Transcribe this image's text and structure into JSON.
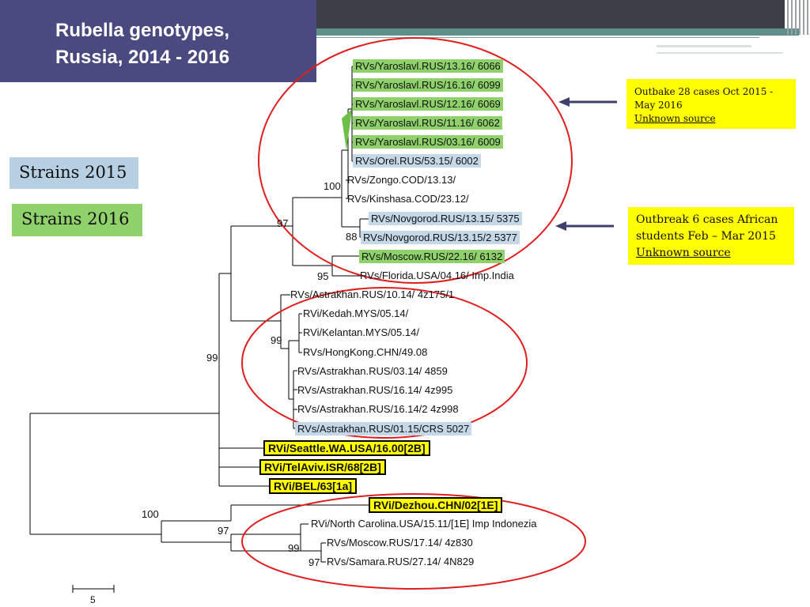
{
  "slide": {
    "title_line1": "Rubella genotypes,",
    "title_line2": "Russia, 2014 - 2016"
  },
  "legend": {
    "strains_2015": "Strains 2015",
    "strains_2016": "Strains 2016",
    "color_2015": "#b7cfe2",
    "color_2016": "#8fd16a"
  },
  "leaves": [
    {
      "label": "RVs/Yaroslavl.RUS/13.16/ 6066",
      "highlight": "green"
    },
    {
      "label": "RVs/Yaroslavl.RUS/16.16/ 6099",
      "highlight": "green"
    },
    {
      "label": "RVs/Yaroslavl.RUS/12.16/ 6069",
      "highlight": "green"
    },
    {
      "label": "RVs/Yaroslavl.RUS/11.16/ 6062",
      "highlight": "green"
    },
    {
      "label": "RVs/Yaroslavl.RUS/03.16/ 6009",
      "highlight": "green"
    },
    {
      "label": "RVs/Orel.RUS/53.15/ 6002",
      "highlight": "blue"
    },
    {
      "label": "RVs/Zongo.COD/13.13/",
      "highlight": "none"
    },
    {
      "label": "RVs/Kinshasa.COD/23.12/",
      "highlight": "none"
    },
    {
      "label": "RVs/Novgorod.RUS/13.15/ 5375",
      "highlight": "blue"
    },
    {
      "label": "RVs/Novgorod.RUS/13.15/2 5377",
      "highlight": "blue"
    },
    {
      "label": "RVs/Moscow.RUS/22.16/ 6132",
      "highlight": "green"
    },
    {
      "label": "RVs/Florida.USA/04.16/ Imp.India",
      "highlight": "none"
    },
    {
      "label": "RVs/Astrakhan.RUS/10.14/ 4z175/1",
      "highlight": "none"
    },
    {
      "label": "RVi/Kedah.MYS/05.14/",
      "highlight": "none"
    },
    {
      "label": "RVi/Kelantan.MYS/05.14/",
      "highlight": "none"
    },
    {
      "label": "RVs/HongKong.CHN/49.08",
      "highlight": "none"
    },
    {
      "label": "RVs/Astrakhan.RUS/03.14/ 4859",
      "highlight": "none"
    },
    {
      "label": "RVs/Astrakhan.RUS/16.14/  4z995",
      "highlight": "none"
    },
    {
      "label": "RVs/Astrakhan.RUS/16.14/2 4z998",
      "highlight": "none"
    },
    {
      "label": "RVs/Astrakhan.RUS/01.15/CRS 5027",
      "highlight": "blue"
    },
    {
      "label": "RVi/Seattle.WA.USA/16.00[2B]",
      "highlight": "yellow"
    },
    {
      "label": "RVi/TelAviv.ISR/68[2B]",
      "highlight": "yellow"
    },
    {
      "label": "RVi/BEL/63[1a]",
      "highlight": "yellow"
    },
    {
      "label": "RVi/Dezhou.CHN/02[1E]",
      "highlight": "yellow"
    },
    {
      "label": "RVi/North Carolina.USA/15.11/[1E] Imp Indonezia",
      "highlight": "none"
    },
    {
      "label": "RVs/Moscow.RUS/17.14/ 4z830",
      "highlight": "none"
    },
    {
      "label": "RVs/Samara.RUS/27.14/ 4N829",
      "highlight": "none"
    }
  ],
  "bootstrap": {
    "n100_top": "100",
    "n97_top": "97",
    "n88": "88",
    "n95": "95",
    "n99_mid": "99",
    "n99_left": "99",
    "n100_bottom": "100",
    "n97_bottom": "97",
    "n99_bottom": "99",
    "n97_last": "97"
  },
  "annotations": {
    "outbreak_2016": {
      "line1": "Outbake 28 cases  Oct 2015 -",
      "line2": "May 2016",
      "line3": "Unknown source"
    },
    "outbreak_2015": {
      "line1": "Outbreak 6 cases African",
      "line2": "students Feb – Mar 2015",
      "line3": "Unknown source"
    }
  },
  "scale_bar": {
    "label": "5"
  },
  "colors": {
    "title_bg": "#4a4a80",
    "circle": "#e01e1e",
    "arrow": "#3f3f6e",
    "note_bg": "#ffff00"
  }
}
